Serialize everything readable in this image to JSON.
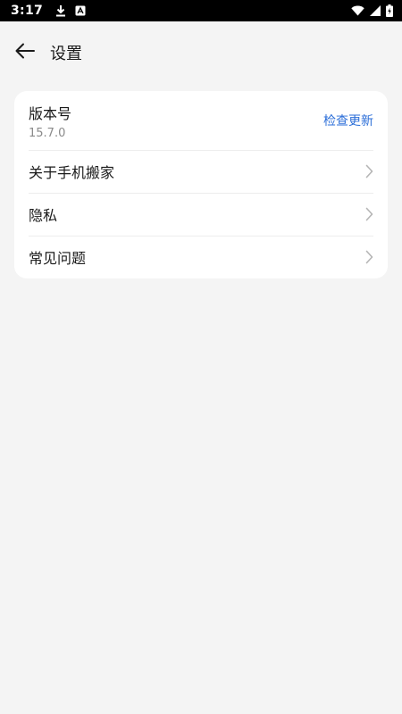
{
  "status_bar": {
    "time": "3:17",
    "icons": [
      "download-icon",
      "app-notification-icon",
      "wifi-icon",
      "signal-icon",
      "battery-charging-icon"
    ]
  },
  "header": {
    "title": "设置",
    "back_icon": "arrow-left-icon"
  },
  "settings": {
    "version": {
      "label": "版本号",
      "value": "15.7.0",
      "action": "检查更新"
    },
    "items": [
      {
        "label": "关于手机搬家",
        "icon": "chevron-right-icon"
      },
      {
        "label": "隐私",
        "icon": "chevron-right-icon"
      },
      {
        "label": "常见问题",
        "icon": "chevron-right-icon"
      }
    ]
  },
  "colors": {
    "background": "#f4f4f4",
    "card": "#ffffff",
    "accent": "#2b6ed8"
  }
}
